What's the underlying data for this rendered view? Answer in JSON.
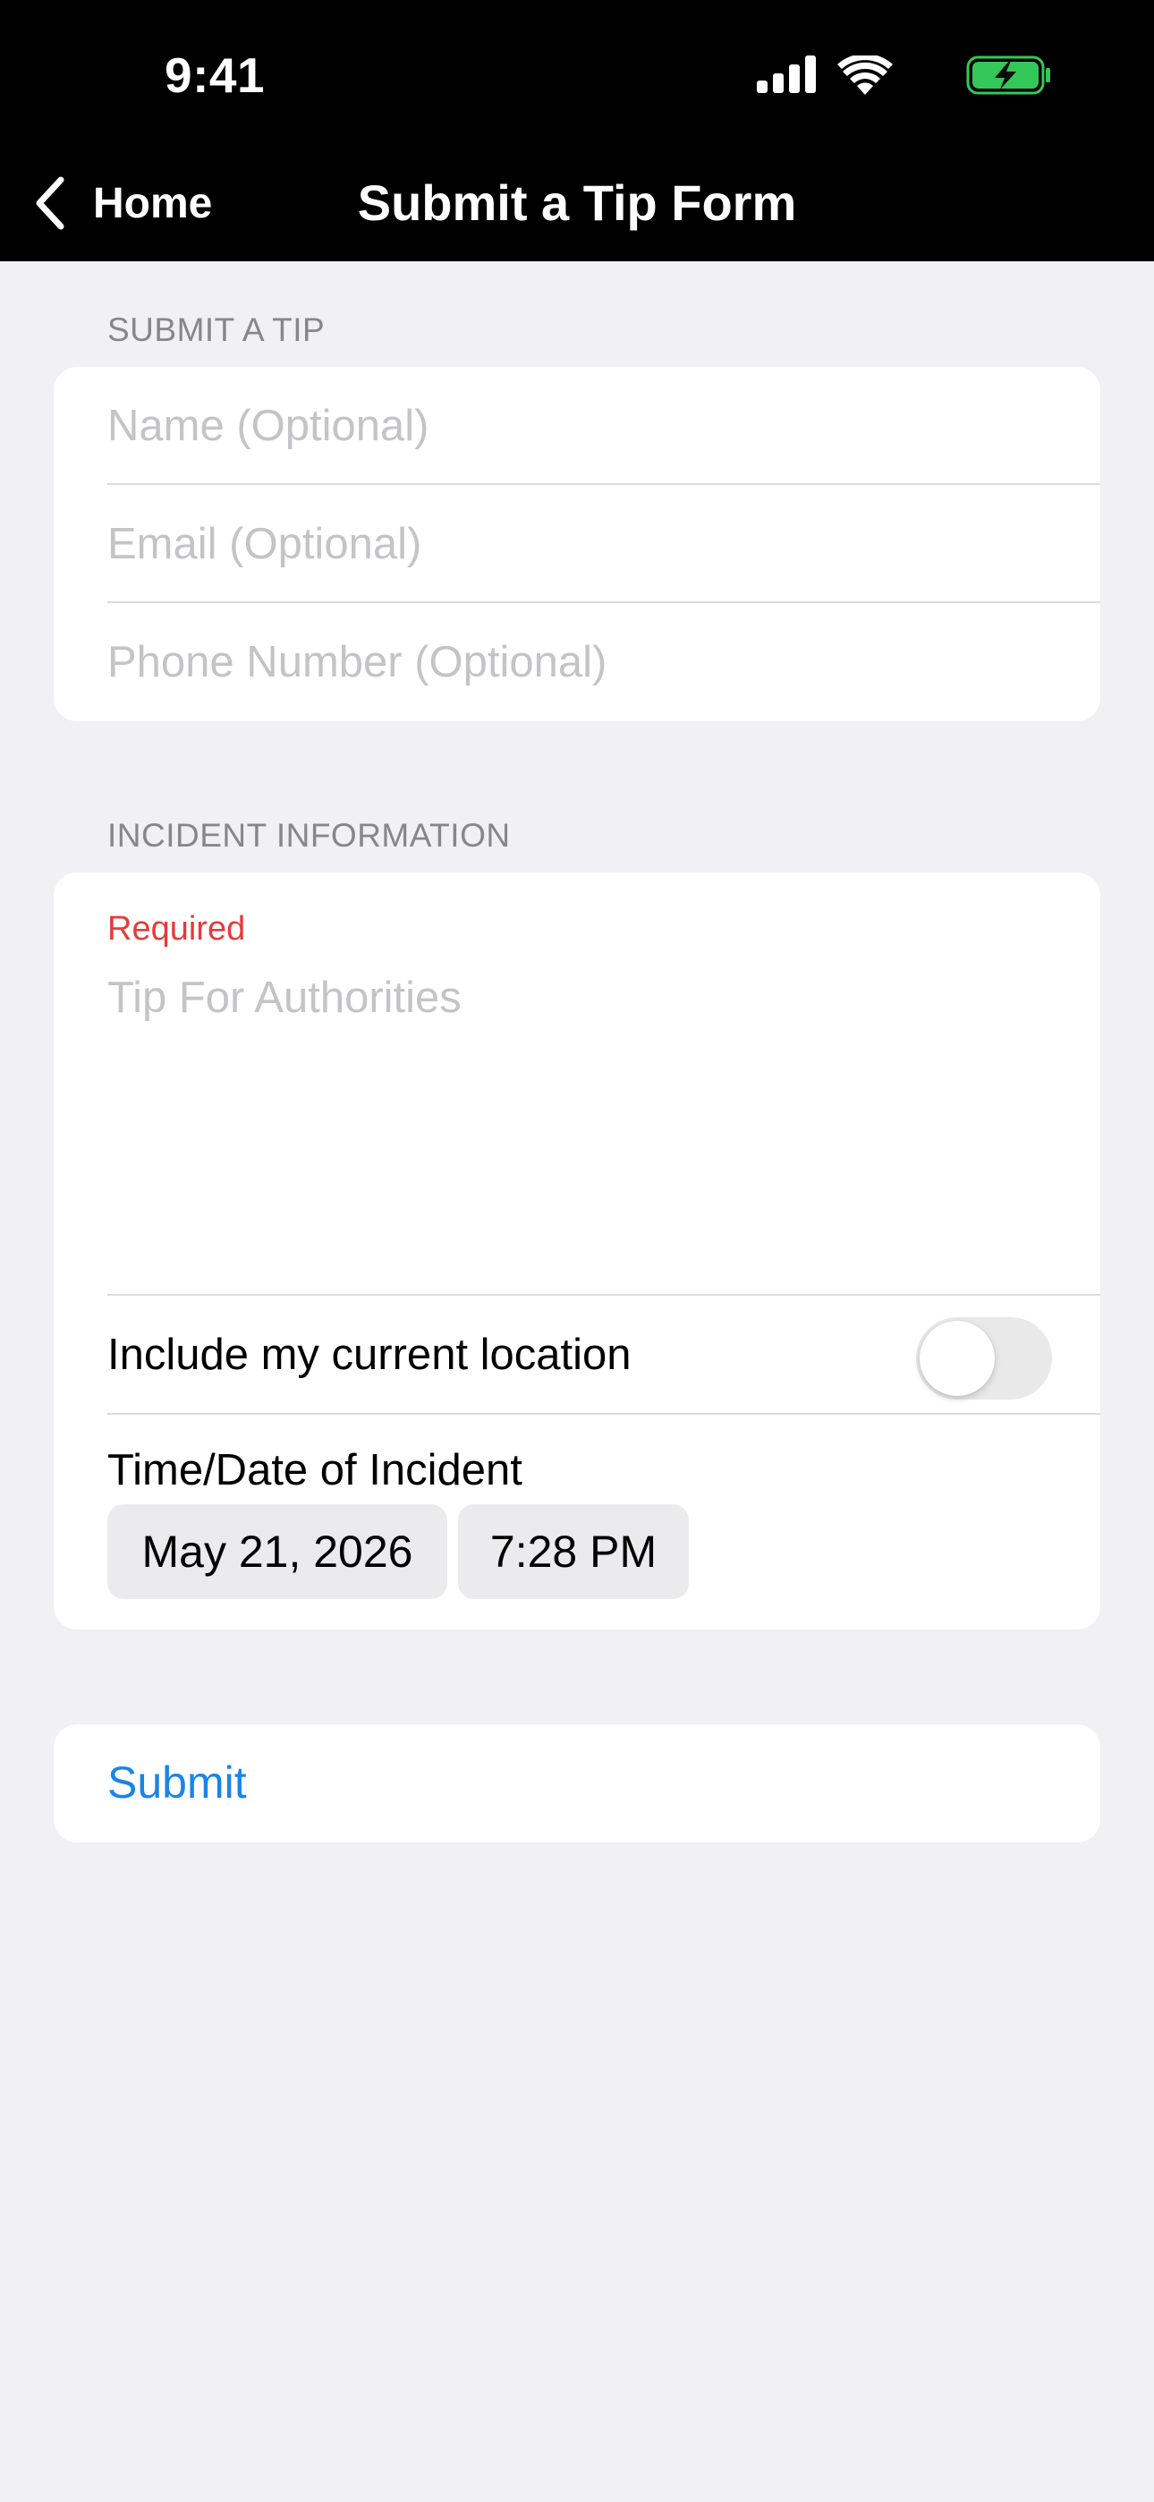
{
  "status_bar": {
    "time": "9:41"
  },
  "nav": {
    "back_label": "Home",
    "title": "Submit a Tip Form"
  },
  "contact_section": {
    "header": "SUBMIT A TIP",
    "name_placeholder": "Name (Optional)",
    "email_placeholder": "Email (Optional)",
    "phone_placeholder": "Phone Number (Optional)"
  },
  "incident_section": {
    "header": "INCIDENT INFORMATION",
    "required_label": "Required",
    "tip_placeholder": "Tip For Authorities",
    "location_label": "Include my current location",
    "location_enabled": false,
    "datetime_label": "Time/Date of Incident",
    "date_value": "May 21, 2026",
    "time_value": "7:28 PM"
  },
  "submit": {
    "label": "Submit"
  },
  "colors": {
    "background": "#f0f0f5",
    "header_background": "#000000",
    "accent": "#1a84e8",
    "required": "#e63b3b",
    "battery": "#34c759"
  }
}
